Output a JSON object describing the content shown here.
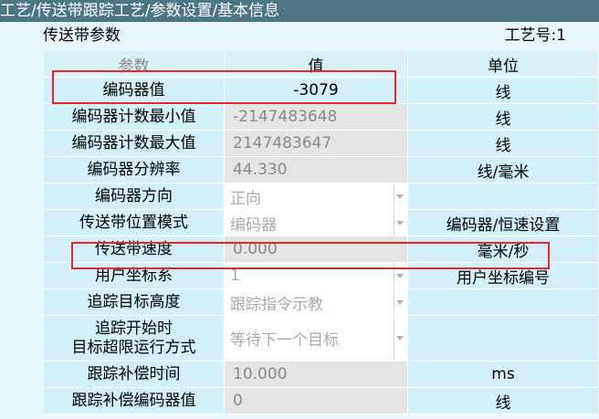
{
  "title": "工艺/传送带跟踪工艺/参数设置/基本信息",
  "section_title": "传送带参数",
  "process_no": "工艺号:1",
  "columns": {
    "param": "参数",
    "value": "值",
    "unit": "单位"
  },
  "rows": [
    {
      "label": "编码器值",
      "value": "-3079",
      "unit": "线"
    },
    {
      "label": "编码器计数最小值",
      "value": "-2147483648",
      "unit": "线"
    },
    {
      "label": "编码器计数最大值",
      "value": "2147483647",
      "unit": "线"
    },
    {
      "label": "编码器分辨率",
      "value": "44.330",
      "unit": "线/毫米"
    },
    {
      "label": "编码器方向",
      "value": "正向",
      "unit": ""
    },
    {
      "label": "传送带位置模式",
      "value": "编码器",
      "unit": "编码器/恒速设置"
    },
    {
      "label": "传送带速度",
      "value": "0.000",
      "unit": "毫米/秒"
    },
    {
      "label": "用户坐标系",
      "value": "1",
      "unit": "用户坐标编号"
    },
    {
      "label": "追踪目标高度",
      "value": "跟踪指令示教",
      "unit": ""
    },
    {
      "label_line1": "追踪开始时",
      "label_line2": "目标超限运行方式",
      "value": "等待下一个目标",
      "unit": ""
    },
    {
      "label": "跟踪补偿时间",
      "value": "10.000",
      "unit": "ms"
    },
    {
      "label": "跟踪补偿编码器值",
      "value": "0",
      "unit": "线"
    }
  ],
  "icons": {
    "dropdown": "chevron-down-icon"
  },
  "colors": {
    "titlebar": "#4e7584",
    "background": "#e8f7fc",
    "cell": "#d3f0f8",
    "highlight_box": "#e0282f"
  }
}
